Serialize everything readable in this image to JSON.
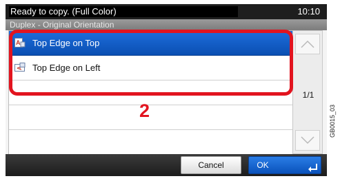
{
  "status": {
    "message": "Ready to copy. (Full Color)",
    "time": "10:10"
  },
  "screen_title": "Duplex - Original Orientation",
  "options": [
    {
      "label": "Top Edge on Top",
      "icon": "orientation-top-icon",
      "selected": true
    },
    {
      "label": "Top Edge on Left",
      "icon": "orientation-left-icon",
      "selected": false
    }
  ],
  "pagination": {
    "indicator": "1/1"
  },
  "buttons": {
    "cancel": "Cancel",
    "ok": "OK"
  },
  "annotation": {
    "step": "2",
    "figure_code": "GB0015_03"
  },
  "colors": {
    "selected": "#0a52bb",
    "highlight": "#e2141f"
  }
}
